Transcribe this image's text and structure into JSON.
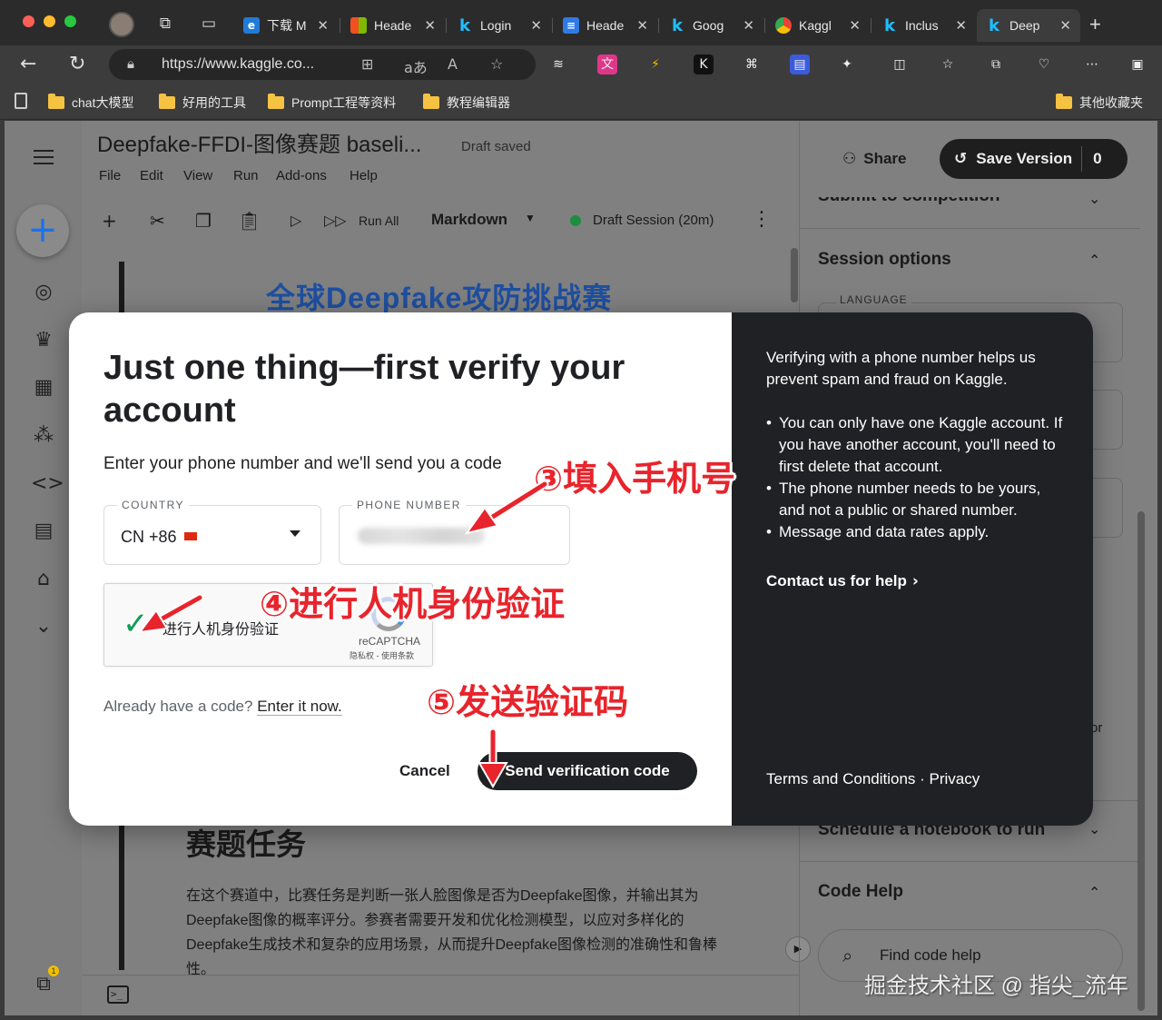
{
  "browser": {
    "tabs": [
      {
        "label": "下载 M",
        "fav_color": "#1f7bd8",
        "fav_glyph": "e"
      },
      {
        "label": "Heade",
        "fav_color": "#f25022",
        "fav_glyph": "■"
      },
      {
        "label": "Login",
        "fav_color": "#20beff",
        "fav_glyph": "k"
      },
      {
        "label": "Heade",
        "fav_color": "#2f7ae5",
        "fav_glyph": "≡"
      },
      {
        "label": "Goog",
        "fav_color": "#20beff",
        "fav_glyph": "k"
      },
      {
        "label": "Kaggl",
        "fav_color": "#ea4335",
        "fav_glyph": "◉"
      },
      {
        "label": "Inclus",
        "fav_color": "#20beff",
        "fav_glyph": "k"
      },
      {
        "label": "Deep",
        "fav_color": "#20beff",
        "fav_glyph": "k"
      }
    ],
    "url": "https://www.kaggle.co...",
    "bookmarks": [
      "chat大模型",
      "好用的工具",
      "Prompt工程等资料",
      "教程编辑器"
    ],
    "other_bookmarks": "其他收藏夹"
  },
  "notebook": {
    "title": "Deepfake-FFDI-图像赛题 baseli...",
    "draft_status": "Draft saved",
    "menu": [
      "File",
      "Edit",
      "View",
      "Run",
      "Add-ons",
      "Help"
    ],
    "share_label": "Share",
    "save_version_label": "Save Version",
    "save_version_count": "0",
    "toolbar": {
      "run_all": "Run All",
      "cell_type": "Markdown",
      "session": "Draft Session (20m)"
    },
    "cell_heading": "全球Deepfake攻防挑战赛",
    "task_title": "赛题任务",
    "task_body": "在这个赛道中，比赛任务是判断一张人脸图像是否为Deepfake图像，并输出其为Deepfake图像的概率评分。参赛者需要开发和优化检测模型，以应对多样化的Deepfake生成技术和复杂的应用场景，从而提升Deepfake图像检测的准确性和鲁棒性。"
  },
  "right_panel": {
    "submit_heading": "Submit to competition",
    "session_options": "Session options",
    "language_label": "LANGUAGE",
    "schedule": "Schedule a notebook to run",
    "code_help": "Code Help",
    "find_code_help": "Find code help",
    "partial_text": "or"
  },
  "modal": {
    "title": "Just one thing—first verify your account",
    "description": "Enter your phone number and we'll send you a code",
    "country_label": "COUNTRY",
    "country_value": "CN +86",
    "phone_label": "PHONE NUMBER",
    "recaptcha_label": "进行人机身份验证",
    "recaptcha_brand": "reCAPTCHA",
    "recaptcha_terms": "隐私权 - 使用条款",
    "already_prefix": "Already have a code?",
    "already_link": "Enter it now.",
    "cancel": "Cancel",
    "send": "Send verification code",
    "info_intro": "Verifying with a phone number helps us prevent spam and fraud on Kaggle.",
    "info_points": [
      "You can only have one Kaggle account. If you have another account, you'll need to first delete that account.",
      "The phone number needs to be yours, and not a public or shared number.",
      "Message and data rates apply."
    ],
    "contact": "Contact us for help",
    "footer": "Terms and Conditions · Privacy"
  },
  "annotations": {
    "step3": "③填入手机号",
    "step4": "④进行人机身份验证",
    "step5": "⑤发送验证码",
    "color": "#e8242c"
  },
  "watermark": "掘金技术社区 @ 指尖_流年"
}
